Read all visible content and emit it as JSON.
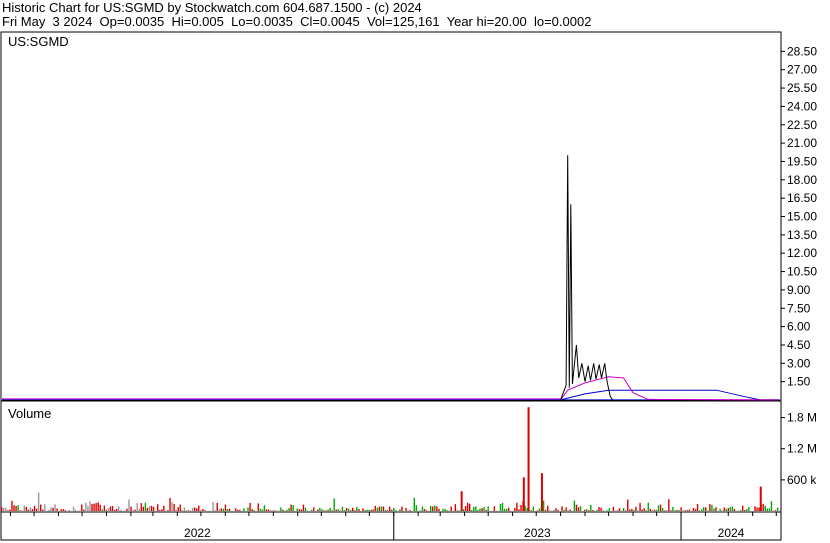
{
  "header": {
    "line1": "Historic Chart for US:SGMD by Stockwatch.com 604.687.1500 - (c) 2024",
    "line2": "Fri May  3 2024  Op=0.0035  Hi=0.005  Lo=0.0035  Cl=0.0045  Vol=125,161  Year hi=20.00  lo=0.0002"
  },
  "colors": {
    "price": "#000000",
    "ma_short": "#cc00cc",
    "ma_long": "#0000cc",
    "volume_up": "#00aa00",
    "volume_down": "#dd0000",
    "volume_flat": "#999999",
    "grid": "#d0d0d0"
  },
  "chart_data": [
    {
      "type": "line",
      "title": "US:SGMD",
      "ylim": [
        0,
        30
      ],
      "y_ticks": [
        "28.50",
        "27.00",
        "25.50",
        "24.00",
        "22.50",
        "21.00",
        "19.50",
        "18.00",
        "16.50",
        "15.00",
        "13.50",
        "12.00",
        "10.50",
        "9.00",
        "7.50",
        "6.00",
        "4.50",
        "3.00",
        "1.50"
      ],
      "x_labels": [
        "2022",
        "2023",
        "2024"
      ],
      "price_series": [
        {
          "x": "2023-08-01",
          "y": 0.01
        },
        {
          "x": "2023-08-08",
          "y": 1.2
        },
        {
          "x": "2023-08-10",
          "y": 20.0
        },
        {
          "x": "2023-08-12",
          "y": 1.0
        },
        {
          "x": "2023-08-14",
          "y": 16.0
        },
        {
          "x": "2023-08-16",
          "y": 1.3
        },
        {
          "x": "2023-08-21",
          "y": 4.5
        },
        {
          "x": "2023-08-24",
          "y": 1.8
        },
        {
          "x": "2023-08-28",
          "y": 3.0
        },
        {
          "x": "2023-09-01",
          "y": 1.5
        },
        {
          "x": "2023-09-05",
          "y": 2.8
        },
        {
          "x": "2023-09-08",
          "y": 1.6
        },
        {
          "x": "2023-09-12",
          "y": 3.0
        },
        {
          "x": "2023-09-15",
          "y": 1.7
        },
        {
          "x": "2023-09-19",
          "y": 2.9
        },
        {
          "x": "2023-09-22",
          "y": 1.8
        },
        {
          "x": "2023-09-26",
          "y": 3.0
        },
        {
          "x": "2023-09-29",
          "y": 1.5
        },
        {
          "x": "2023-10-03",
          "y": 0.3
        },
        {
          "x": "2023-10-06",
          "y": 0.01
        }
      ],
      "ma_short": [
        {
          "x": "2023-08-01",
          "y": 0.01
        },
        {
          "x": "2023-08-10",
          "y": 0.8
        },
        {
          "x": "2023-09-01",
          "y": 1.4
        },
        {
          "x": "2023-10-01",
          "y": 1.9
        },
        {
          "x": "2023-10-20",
          "y": 1.8
        },
        {
          "x": "2023-11-01",
          "y": 0.6
        },
        {
          "x": "2023-11-20",
          "y": 0.05
        },
        {
          "x": "2024-05-03",
          "y": 0.01
        }
      ],
      "ma_long": [
        {
          "x": "2023-08-01",
          "y": 0.01
        },
        {
          "x": "2023-09-01",
          "y": 0.5
        },
        {
          "x": "2023-10-01",
          "y": 0.8
        },
        {
          "x": "2024-02-15",
          "y": 0.8
        },
        {
          "x": "2024-03-20",
          "y": 0.3
        },
        {
          "x": "2024-04-10",
          "y": 0.02
        },
        {
          "x": "2024-05-03",
          "y": 0.01
        }
      ]
    },
    {
      "type": "bar",
      "title": "Volume",
      "ylim": [
        0,
        2100000
      ],
      "y_ticks": [
        "1.8 M",
        "1.2 M",
        "600 k"
      ],
      "y_tick_values": [
        1800000,
        1200000,
        600000
      ],
      "highlights": [
        {
          "x": "2023-06-20",
          "value": 2000000
        },
        {
          "x": "2023-07-07",
          "value": 730000
        },
        {
          "x": "2023-06-14",
          "value": 650000
        },
        {
          "x": "2023-03-27",
          "value": 380000
        },
        {
          "x": "2024-04-10",
          "value": 470000
        }
      ]
    }
  ]
}
